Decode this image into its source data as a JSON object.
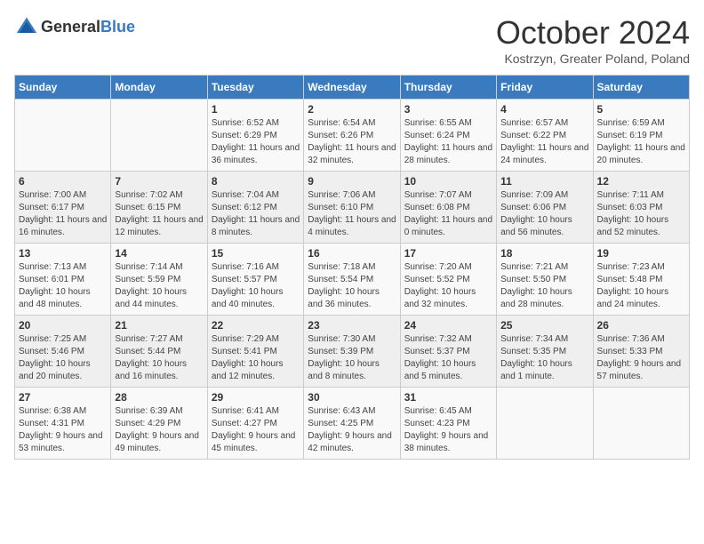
{
  "header": {
    "logo_general": "General",
    "logo_blue": "Blue",
    "month": "October 2024",
    "location": "Kostrzyn, Greater Poland, Poland"
  },
  "days_of_week": [
    "Sunday",
    "Monday",
    "Tuesday",
    "Wednesday",
    "Thursday",
    "Friday",
    "Saturday"
  ],
  "weeks": [
    [
      {
        "day": "",
        "info": ""
      },
      {
        "day": "",
        "info": ""
      },
      {
        "day": "1",
        "info": "Sunrise: 6:52 AM\nSunset: 6:29 PM\nDaylight: 11 hours and 36 minutes."
      },
      {
        "day": "2",
        "info": "Sunrise: 6:54 AM\nSunset: 6:26 PM\nDaylight: 11 hours and 32 minutes."
      },
      {
        "day": "3",
        "info": "Sunrise: 6:55 AM\nSunset: 6:24 PM\nDaylight: 11 hours and 28 minutes."
      },
      {
        "day": "4",
        "info": "Sunrise: 6:57 AM\nSunset: 6:22 PM\nDaylight: 11 hours and 24 minutes."
      },
      {
        "day": "5",
        "info": "Sunrise: 6:59 AM\nSunset: 6:19 PM\nDaylight: 11 hours and 20 minutes."
      }
    ],
    [
      {
        "day": "6",
        "info": "Sunrise: 7:00 AM\nSunset: 6:17 PM\nDaylight: 11 hours and 16 minutes."
      },
      {
        "day": "7",
        "info": "Sunrise: 7:02 AM\nSunset: 6:15 PM\nDaylight: 11 hours and 12 minutes."
      },
      {
        "day": "8",
        "info": "Sunrise: 7:04 AM\nSunset: 6:12 PM\nDaylight: 11 hours and 8 minutes."
      },
      {
        "day": "9",
        "info": "Sunrise: 7:06 AM\nSunset: 6:10 PM\nDaylight: 11 hours and 4 minutes."
      },
      {
        "day": "10",
        "info": "Sunrise: 7:07 AM\nSunset: 6:08 PM\nDaylight: 11 hours and 0 minutes."
      },
      {
        "day": "11",
        "info": "Sunrise: 7:09 AM\nSunset: 6:06 PM\nDaylight: 10 hours and 56 minutes."
      },
      {
        "day": "12",
        "info": "Sunrise: 7:11 AM\nSunset: 6:03 PM\nDaylight: 10 hours and 52 minutes."
      }
    ],
    [
      {
        "day": "13",
        "info": "Sunrise: 7:13 AM\nSunset: 6:01 PM\nDaylight: 10 hours and 48 minutes."
      },
      {
        "day": "14",
        "info": "Sunrise: 7:14 AM\nSunset: 5:59 PM\nDaylight: 10 hours and 44 minutes."
      },
      {
        "day": "15",
        "info": "Sunrise: 7:16 AM\nSunset: 5:57 PM\nDaylight: 10 hours and 40 minutes."
      },
      {
        "day": "16",
        "info": "Sunrise: 7:18 AM\nSunset: 5:54 PM\nDaylight: 10 hours and 36 minutes."
      },
      {
        "day": "17",
        "info": "Sunrise: 7:20 AM\nSunset: 5:52 PM\nDaylight: 10 hours and 32 minutes."
      },
      {
        "day": "18",
        "info": "Sunrise: 7:21 AM\nSunset: 5:50 PM\nDaylight: 10 hours and 28 minutes."
      },
      {
        "day": "19",
        "info": "Sunrise: 7:23 AM\nSunset: 5:48 PM\nDaylight: 10 hours and 24 minutes."
      }
    ],
    [
      {
        "day": "20",
        "info": "Sunrise: 7:25 AM\nSunset: 5:46 PM\nDaylight: 10 hours and 20 minutes."
      },
      {
        "day": "21",
        "info": "Sunrise: 7:27 AM\nSunset: 5:44 PM\nDaylight: 10 hours and 16 minutes."
      },
      {
        "day": "22",
        "info": "Sunrise: 7:29 AM\nSunset: 5:41 PM\nDaylight: 10 hours and 12 minutes."
      },
      {
        "day": "23",
        "info": "Sunrise: 7:30 AM\nSunset: 5:39 PM\nDaylight: 10 hours and 8 minutes."
      },
      {
        "day": "24",
        "info": "Sunrise: 7:32 AM\nSunset: 5:37 PM\nDaylight: 10 hours and 5 minutes."
      },
      {
        "day": "25",
        "info": "Sunrise: 7:34 AM\nSunset: 5:35 PM\nDaylight: 10 hours and 1 minute."
      },
      {
        "day": "26",
        "info": "Sunrise: 7:36 AM\nSunset: 5:33 PM\nDaylight: 9 hours and 57 minutes."
      }
    ],
    [
      {
        "day": "27",
        "info": "Sunrise: 6:38 AM\nSunset: 4:31 PM\nDaylight: 9 hours and 53 minutes."
      },
      {
        "day": "28",
        "info": "Sunrise: 6:39 AM\nSunset: 4:29 PM\nDaylight: 9 hours and 49 minutes."
      },
      {
        "day": "29",
        "info": "Sunrise: 6:41 AM\nSunset: 4:27 PM\nDaylight: 9 hours and 45 minutes."
      },
      {
        "day": "30",
        "info": "Sunrise: 6:43 AM\nSunset: 4:25 PM\nDaylight: 9 hours and 42 minutes."
      },
      {
        "day": "31",
        "info": "Sunrise: 6:45 AM\nSunset: 4:23 PM\nDaylight: 9 hours and 38 minutes."
      },
      {
        "day": "",
        "info": ""
      },
      {
        "day": "",
        "info": ""
      }
    ]
  ]
}
